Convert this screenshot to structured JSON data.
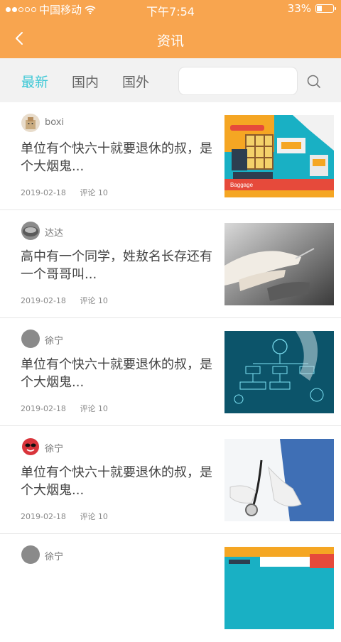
{
  "status_bar": {
    "carrier": "中国移动",
    "time": "下午7:54",
    "battery": "33%",
    "battery_level": 0.33
  },
  "header": {
    "title": "资讯"
  },
  "tabs": [
    {
      "label": "最新",
      "active": true
    },
    {
      "label": "国内",
      "active": false
    },
    {
      "label": "国外",
      "active": false
    }
  ],
  "search": {
    "placeholder": ""
  },
  "articles": [
    {
      "author": "boxi",
      "title": "单位有个快六十就要退休的叔，是个大烟鬼...",
      "date": "2019-02-18",
      "comments": "评论  10",
      "thumb_label": "Baggage"
    },
    {
      "author": "达达",
      "title": "高中有一个同学，姓敖名长存还有一个哥哥叫...",
      "date": "2019-02-18",
      "comments": "评论  10"
    },
    {
      "author": "徐宁",
      "title": "单位有个快六十就要退休的叔，是个大烟鬼...",
      "date": "2019-02-18",
      "comments": "评论  10"
    },
    {
      "author": "徐宁",
      "title": "单位有个快六十就要退休的叔，是个大烟鬼...",
      "date": "2019-02-18",
      "comments": "评论  10"
    },
    {
      "author": "徐宁"
    }
  ],
  "colors": {
    "brand": "#f8a54f",
    "tab_active": "#3ec8d6"
  }
}
